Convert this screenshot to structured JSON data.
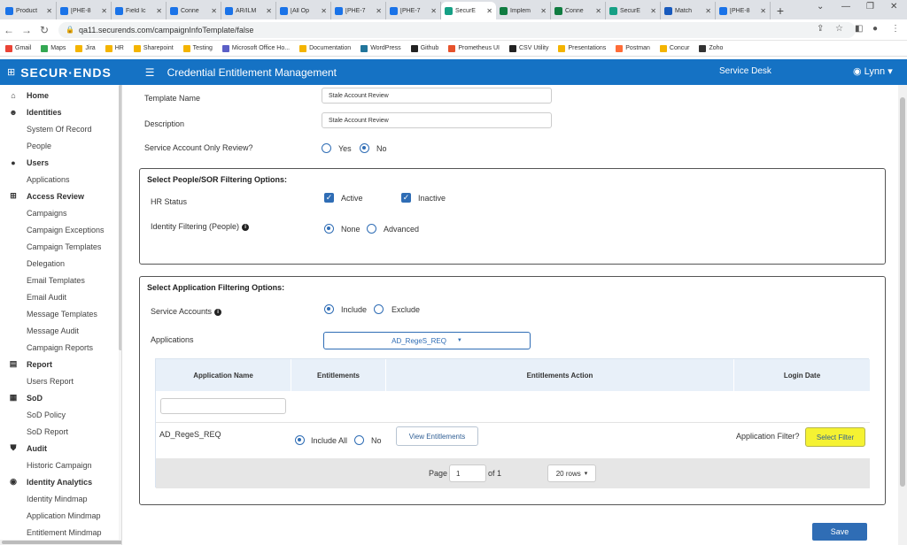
{
  "browser": {
    "tabs": [
      {
        "label": "Product",
        "color": "#1a73e8"
      },
      {
        "label": "[PHE-8",
        "color": "#1a73e8"
      },
      {
        "label": "Field Ic",
        "color": "#1a73e8"
      },
      {
        "label": "Conne",
        "color": "#1a73e8"
      },
      {
        "label": "AR/ILM",
        "color": "#1a73e8"
      },
      {
        "label": "[All Op",
        "color": "#1a73e8"
      },
      {
        "label": "[PHE-7",
        "color": "#1a73e8"
      },
      {
        "label": "[PHE-7",
        "color": "#1a73e8"
      },
      {
        "label": "SecurE",
        "color": "#16a085",
        "active": true
      },
      {
        "label": "Implem",
        "color": "#107c41"
      },
      {
        "label": "Conne",
        "color": "#107c41"
      },
      {
        "label": "SecurE",
        "color": "#16a085"
      },
      {
        "label": "Match",
        "color": "#185abd"
      },
      {
        "label": "[PHE-8",
        "color": "#1a73e8"
      }
    ],
    "close_glyph": "✕",
    "newtab_glyph": "+",
    "url": "qa11.securends.com/campaignInfoTemplate/false",
    "bookmarks": [
      {
        "label": "Gmail",
        "color": "#ea4335"
      },
      {
        "label": "Maps",
        "color": "#34a853"
      },
      {
        "label": "Jira",
        "color": "#f4b400"
      },
      {
        "label": "HR",
        "color": "#f4b400"
      },
      {
        "label": "Sharepoint",
        "color": "#f4b400"
      },
      {
        "label": "Testing",
        "color": "#f4b400"
      },
      {
        "label": "Microsoft Office Ho...",
        "color": "#5b5fc7"
      },
      {
        "label": "Documentation",
        "color": "#f4b400"
      },
      {
        "label": "WordPress",
        "color": "#21759b"
      },
      {
        "label": "Github",
        "color": "#222222"
      },
      {
        "label": "Prometheus UI",
        "color": "#e6522c"
      },
      {
        "label": "CSV Utility",
        "color": "#222222"
      },
      {
        "label": "Presentations",
        "color": "#f4b400"
      },
      {
        "label": "Postman",
        "color": "#ff6c37"
      },
      {
        "label": "Concur",
        "color": "#f4b400"
      },
      {
        "label": "Zoho",
        "color": "#333333"
      }
    ]
  },
  "app": {
    "logo": "SECUR·ENDS",
    "title": "Credential Entitlement Management",
    "service_desk": "Service Desk",
    "user": "Lynn",
    "brand_color": "#1572c4"
  },
  "sidebar": [
    {
      "type": "section",
      "label": "Home",
      "icon": "home-icon",
      "glyph": "⌂"
    },
    {
      "type": "section",
      "label": "Identities",
      "icon": "users-icon",
      "glyph": "☻"
    },
    {
      "type": "item",
      "label": "System Of Record"
    },
    {
      "type": "item",
      "label": "People"
    },
    {
      "type": "section",
      "label": "Users",
      "icon": "user-icon",
      "glyph": "●"
    },
    {
      "type": "item",
      "label": "Applications"
    },
    {
      "type": "section",
      "label": "Access Review",
      "icon": "grid-icon",
      "glyph": "⊞"
    },
    {
      "type": "item",
      "label": "Campaigns"
    },
    {
      "type": "item",
      "label": "Campaign Exceptions"
    },
    {
      "type": "item",
      "label": "Campaign Templates"
    },
    {
      "type": "item",
      "label": "Delegation"
    },
    {
      "type": "item",
      "label": "Email Templates"
    },
    {
      "type": "item",
      "label": "Email Audit"
    },
    {
      "type": "item",
      "label": "Message Templates"
    },
    {
      "type": "item",
      "label": "Message Audit"
    },
    {
      "type": "item",
      "label": "Campaign Reports"
    },
    {
      "type": "section",
      "label": "Report",
      "icon": "file-icon",
      "glyph": "▤"
    },
    {
      "type": "item",
      "label": "Users Report"
    },
    {
      "type": "section",
      "label": "SoD",
      "icon": "table-icon",
      "glyph": "▦"
    },
    {
      "type": "item",
      "label": "SoD Policy"
    },
    {
      "type": "item",
      "label": "SoD Report"
    },
    {
      "type": "section",
      "label": "Audit",
      "icon": "shield-icon",
      "glyph": "⛊"
    },
    {
      "type": "item",
      "label": "Historic Campaign"
    },
    {
      "type": "section",
      "label": "Identity Analytics",
      "icon": "brain-icon",
      "glyph": "◉"
    },
    {
      "type": "item",
      "label": "Identity Mindmap"
    },
    {
      "type": "item",
      "label": "Application Mindmap"
    },
    {
      "type": "item",
      "label": "Entitlement Mindmap"
    }
  ],
  "form": {
    "template_name_label": "Template Name",
    "template_name_value": "Stale Account Review",
    "description_label": "Description",
    "description_value": "Stale Account Review",
    "service_only_label": "Service Account Only Review?",
    "yes_label": "Yes",
    "no_label": "No",
    "service_only_selected": "No"
  },
  "people_filter": {
    "title": "Select People/SOR Filtering Options:",
    "hr_status_label": "HR Status",
    "active_label": "Active",
    "inactive_label": "Inactive",
    "active_checked": true,
    "inactive_checked": true,
    "identity_filter_label": "Identity Filtering (People)",
    "none_label": "None",
    "advanced_label": "Advanced",
    "identity_filter_selected": "None"
  },
  "app_filter": {
    "title": "Select Application Filtering Options:",
    "service_accounts_label": "Service Accounts",
    "include_label": "Include",
    "exclude_label": "Exclude",
    "service_accounts_selected": "Include",
    "applications_label": "Applications",
    "applications_value": "AD_RegeS_REQ",
    "dropdown_caret": "▼"
  },
  "table": {
    "columns": [
      "Application Name",
      "Entitlements",
      "Entitlements Action",
      "Login Date"
    ],
    "filter_placeholder": "",
    "rows": [
      {
        "application": "AD_RegeS_REQ",
        "include_all_label": "Include All",
        "no_label": "No",
        "selected": "Include All",
        "view_entitlements": "View Entitlements",
        "app_filter_label": "Application Filter?",
        "select_filter": "Select Filter"
      }
    ],
    "pager": {
      "page_label": "Page",
      "page_value": "1",
      "of_label": "of 1",
      "rows_option": "20 rows"
    }
  },
  "save_label": "Save",
  "highlight_color": "#f5f232"
}
